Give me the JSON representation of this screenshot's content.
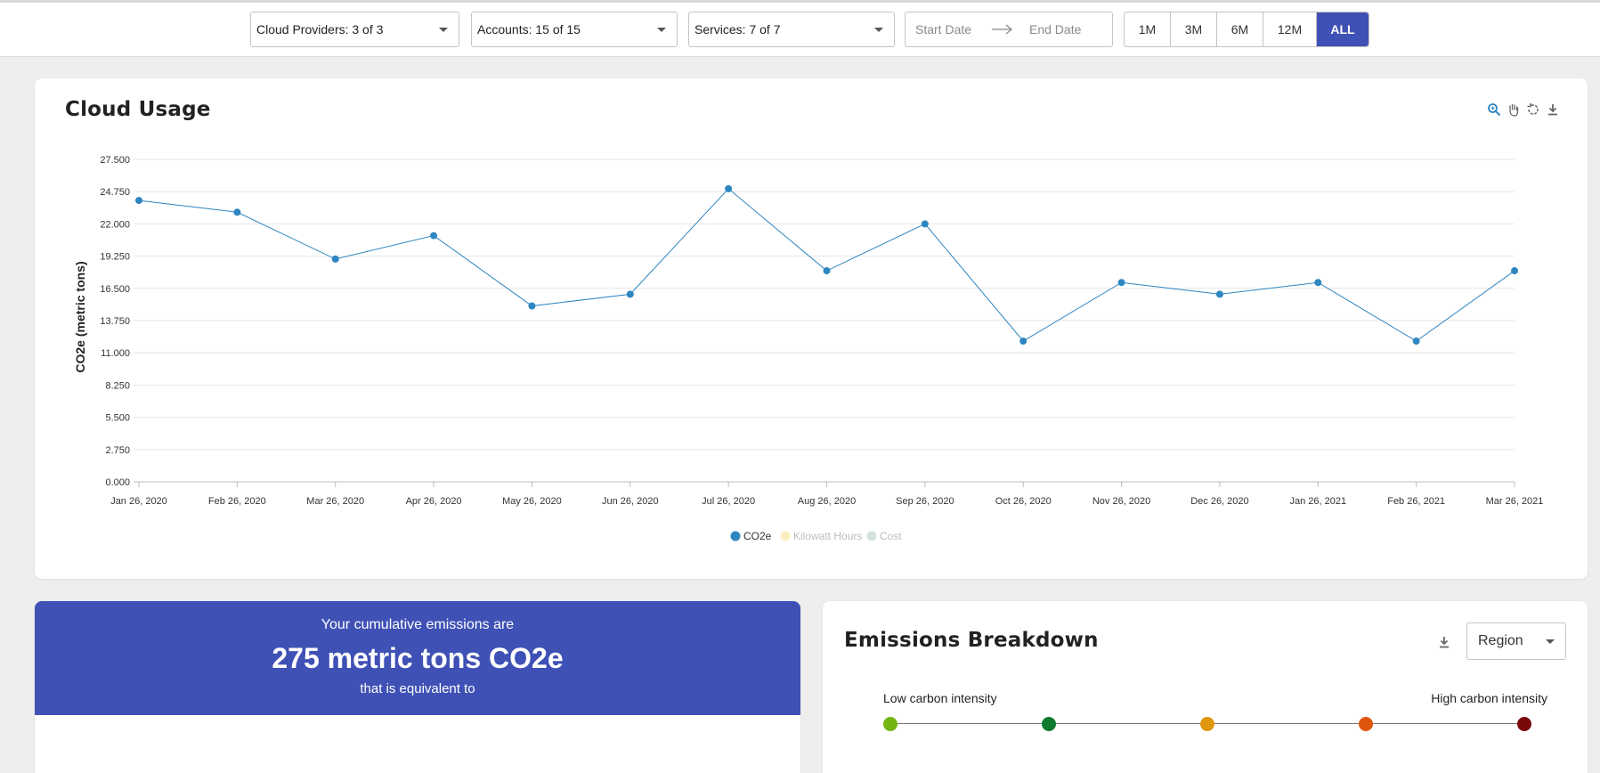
{
  "filters": {
    "cloud_providers": "Cloud Providers: 3 of 3",
    "accounts": "Accounts: 15 of 15",
    "services": "Services: 7 of 7",
    "start_date_placeholder": "Start Date",
    "end_date_placeholder": "End Date",
    "ranges": [
      "1M",
      "3M",
      "6M",
      "12M",
      "ALL"
    ],
    "active_range": "ALL"
  },
  "usage_card": {
    "title": "Cloud Usage",
    "toolbar": [
      "zoom-icon",
      "pan-hand-icon",
      "reset-icon",
      "download-icon"
    ]
  },
  "chart_data": {
    "type": "line",
    "title": "",
    "xlabel": "",
    "ylabel": "CO2e (metric tons)",
    "ylim": [
      0,
      27.5
    ],
    "yticks": [
      "0.000",
      "2.750",
      "5.500",
      "8.250",
      "11.000",
      "13.750",
      "16.500",
      "19.250",
      "22.000",
      "24.750",
      "27.500"
    ],
    "categories": [
      "Jan 26, 2020",
      "Feb 26, 2020",
      "Mar 26, 2020",
      "Apr 26, 2020",
      "May 26, 2020",
      "Jun 26, 2020",
      "Jul 26, 2020",
      "Aug 26, 2020",
      "Sep 26, 2020",
      "Oct 26, 2020",
      "Nov 26, 2020",
      "Dec 26, 2020",
      "Jan 26, 2021",
      "Feb 26, 2021",
      "Mar 26, 2021"
    ],
    "series": [
      {
        "name": "CO2e",
        "color": "#2e86c1",
        "active": true,
        "values": [
          24,
          23,
          19,
          21,
          15,
          16,
          25,
          18,
          22,
          12,
          17,
          16,
          17,
          12,
          18
        ]
      },
      {
        "name": "Kilowatt Hours",
        "color": "#fbeec1",
        "active": false
      },
      {
        "name": "Cost",
        "color": "#d6e0dc",
        "active": false
      }
    ],
    "grid": true,
    "legend": "bottom-center"
  },
  "cumulative": {
    "line1": "Your cumulative emissions are",
    "big": "275 metric tons CO2e",
    "line2": "that is equivalent to"
  },
  "breakdown": {
    "title": "Emissions Breakdown",
    "group_by": "Region",
    "low_label": "Low carbon intensity",
    "high_label": "High carbon intensity",
    "intensity_colors": [
      "#73b512",
      "#0d7a2d",
      "#e0960d",
      "#e0560d",
      "#7a0a0a"
    ]
  },
  "colors": {
    "accent": "#3f51b5",
    "line": "#2e86c1"
  }
}
